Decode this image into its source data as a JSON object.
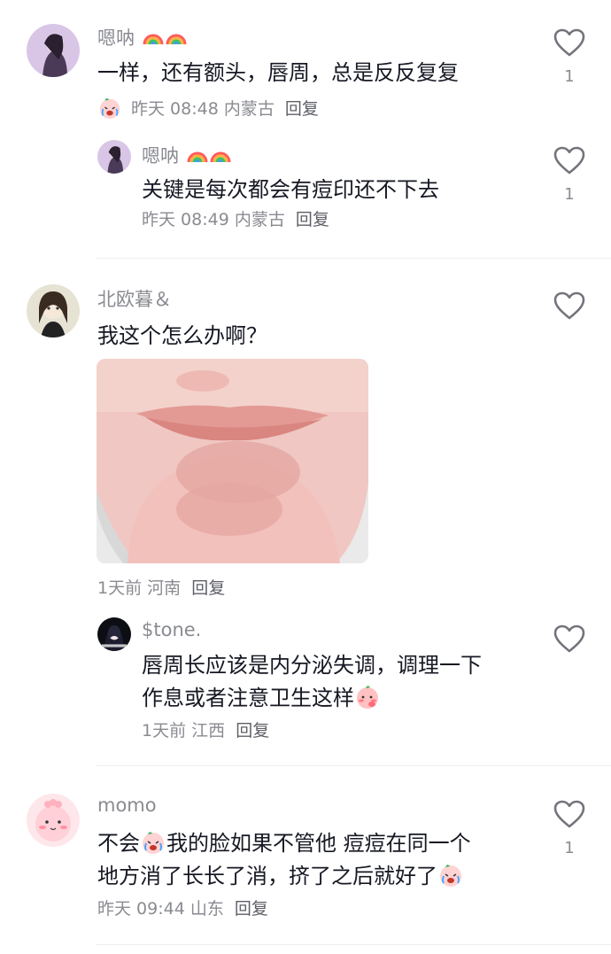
{
  "comments": [
    {
      "username": "嗯呐",
      "text": "一样，还有额头，唇周，总是反反复复",
      "time": "昨天 08:48",
      "location": "内蒙古",
      "reply_label": "回复",
      "likes": "1",
      "replies": [
        {
          "username": "嗯呐",
          "text": "关键是每次都会有痘印还不下去",
          "time": "昨天 08:49",
          "location": "内蒙古",
          "reply_label": "回复",
          "likes": "1"
        }
      ]
    },
    {
      "username": "北欧暮＆",
      "text": "我这个怎么办啊？",
      "time": "1天前",
      "location": "河南",
      "reply_label": "回复",
      "likes": "",
      "replies": [
        {
          "username": "$tone.",
          "text_line1": "唇周长应该是内分泌失调，调理一下",
          "text_line2": "作息或者注意卫生这样",
          "time": "1天前",
          "location": "江西",
          "reply_label": "回复",
          "likes": ""
        }
      ]
    },
    {
      "username": "momo",
      "text_a": "不会",
      "text_b": "我的脸如果不管他 痘痘在同一个",
      "text_line2": "地方消了长长了消，挤了之后就好了",
      "time": "昨天 09:44",
      "location": "山东",
      "reply_label": "回复",
      "likes": "1"
    }
  ],
  "icons": {
    "like": "heart-outline-icon",
    "rainbow": "rainbow-emoji-icon",
    "cry": "crying-emoji-icon",
    "shy": "peach-shy-emoji-icon"
  },
  "colors": {
    "text": "#161823",
    "secondary": "#8a8b91",
    "divider": "#eeeeee"
  }
}
